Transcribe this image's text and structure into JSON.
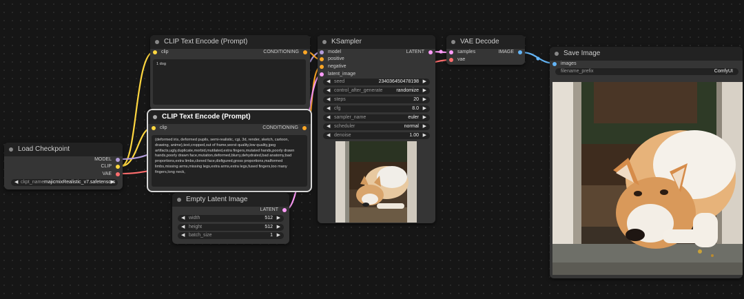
{
  "nodes": {
    "load_checkpoint": {
      "title": "Load Checkpoint",
      "outputs": [
        "MODEL",
        "CLIP",
        "VAE"
      ],
      "ckpt_label": "ckpt_name",
      "ckpt_value": "majicmixRealistic_v7.safetensors"
    },
    "clip_positive": {
      "title": "CLIP Text Encode (Prompt)",
      "input": "clip",
      "output": "CONDITIONING",
      "text": "1 dog"
    },
    "clip_negative": {
      "title": "CLIP Text Encode (Prompt)",
      "input": "clip",
      "output": "CONDITIONING",
      "text": "(deformed iris, deformed pupils, semi-realistic, cgi, 3d, render, sketch, cartoon, drawing, anime),text,cropped,out of frame,worst quality,low quality,jpeg artifacts,ugly,duplicate,morbid,mutilated,extra fingers,mutated hands,poorly drawn hands,poorly drawn face,mutation,deformed,blurry,dehydrated,bad anatomy,bad proportions,extra limbs,cloned face,disfigured,gross proportions,malformed limbs,missing arms,missing legs,extra arms,extra legs,fused fingers,too many fingers,long neck,"
    },
    "empty_latent": {
      "title": "Empty Latent Image",
      "output": "LATENT",
      "widgets": [
        {
          "label": "width",
          "value": "512"
        },
        {
          "label": "height",
          "value": "512"
        },
        {
          "label": "batch_size",
          "value": "1"
        }
      ]
    },
    "ksampler": {
      "title": "KSampler",
      "inputs": [
        "model",
        "positive",
        "negative",
        "latent_image"
      ],
      "output": "LATENT",
      "widgets": [
        {
          "label": "seed",
          "value": "234036450478198"
        },
        {
          "label": "control_after_generate",
          "value": "randomize"
        },
        {
          "label": "steps",
          "value": "20"
        },
        {
          "label": "cfg",
          "value": "8.0"
        },
        {
          "label": "sampler_name",
          "value": "euler"
        },
        {
          "label": "scheduler",
          "value": "normal"
        },
        {
          "label": "denoise",
          "value": "1.00"
        }
      ]
    },
    "vae_decode": {
      "title": "VAE Decode",
      "inputs": [
        "samples",
        "vae"
      ],
      "output": "IMAGE"
    },
    "save_image": {
      "title": "Save Image",
      "input": "images",
      "prefix_label": "filename_prefix",
      "prefix_value": "ComfyUI"
    }
  },
  "colors": {
    "model": "#b39ddb",
    "clip": "#ffd740",
    "vae": "#ff6e6e",
    "conditioning": "#ffa726",
    "latent": "#ff9cf9",
    "image": "#64b5f6"
  }
}
